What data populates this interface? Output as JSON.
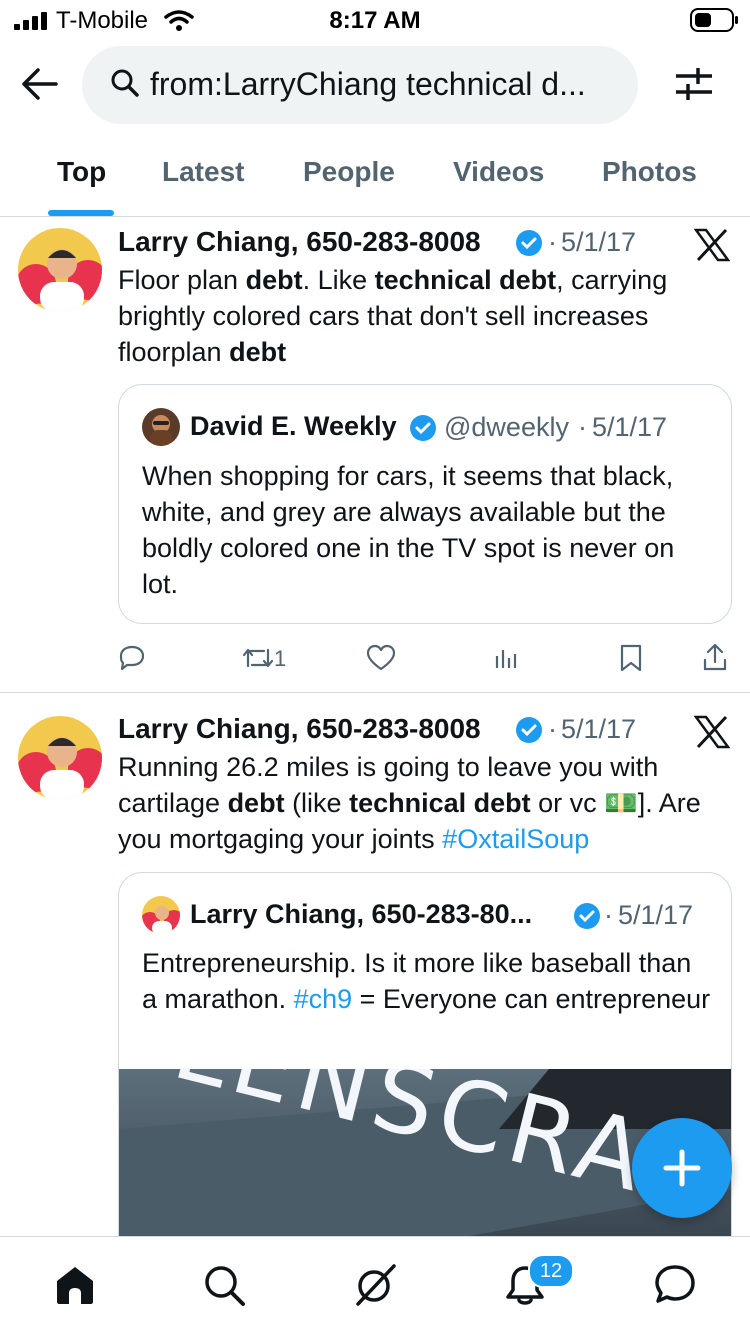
{
  "status_bar": {
    "carrier": "T-Mobile",
    "time": "8:17 AM"
  },
  "search": {
    "query": "from:LarryChiang technical d..."
  },
  "tabs": [
    {
      "label": "Top",
      "active": true
    },
    {
      "label": "Latest"
    },
    {
      "label": "People"
    },
    {
      "label": "Videos"
    },
    {
      "label": "Photos"
    }
  ],
  "tweets": [
    {
      "author": "Larry Chiang, 650-283-8008",
      "date": "5/1/17",
      "text_parts": [
        "Floor plan ",
        "debt",
        ". Like ",
        "technical debt",
        ", carrying brightly colored cars that don't sell increases floorplan ",
        "debt"
      ],
      "quote": {
        "author": "David E. Weekly",
        "handle": "@dweekly",
        "date": "5/1/17",
        "text": "When shopping for cars, it seems that black, white, and grey are always available but the boldly colored one in the TV spot is never on lot."
      },
      "actions": {
        "retweets": "1"
      }
    },
    {
      "author": "Larry Chiang, 650-283-8008",
      "date": "5/1/17",
      "text_parts": [
        "Running 26.2 miles is going to leave you with cartilage ",
        "debt",
        " (like ",
        "technical debt",
        " or vc ",
        "💵",
        "]. Are you mortgaging your joints ",
        "#OxtailSoup"
      ],
      "quote": {
        "author": "Larry Chiang, 650-283-80...",
        "date": "5/1/17",
        "text_parts": [
          "Entrepreneurship. Is it more like baseball than a marathon. ",
          "#ch9",
          " = Everyone can entrepreneur"
        ],
        "image_text": "LENSCRA"
      }
    }
  ],
  "notifications_badge": "12",
  "colors": {
    "accent": "#1d9bf0",
    "text": "#0f1419",
    "secondary": "#536471",
    "border": "#cfd9de"
  }
}
